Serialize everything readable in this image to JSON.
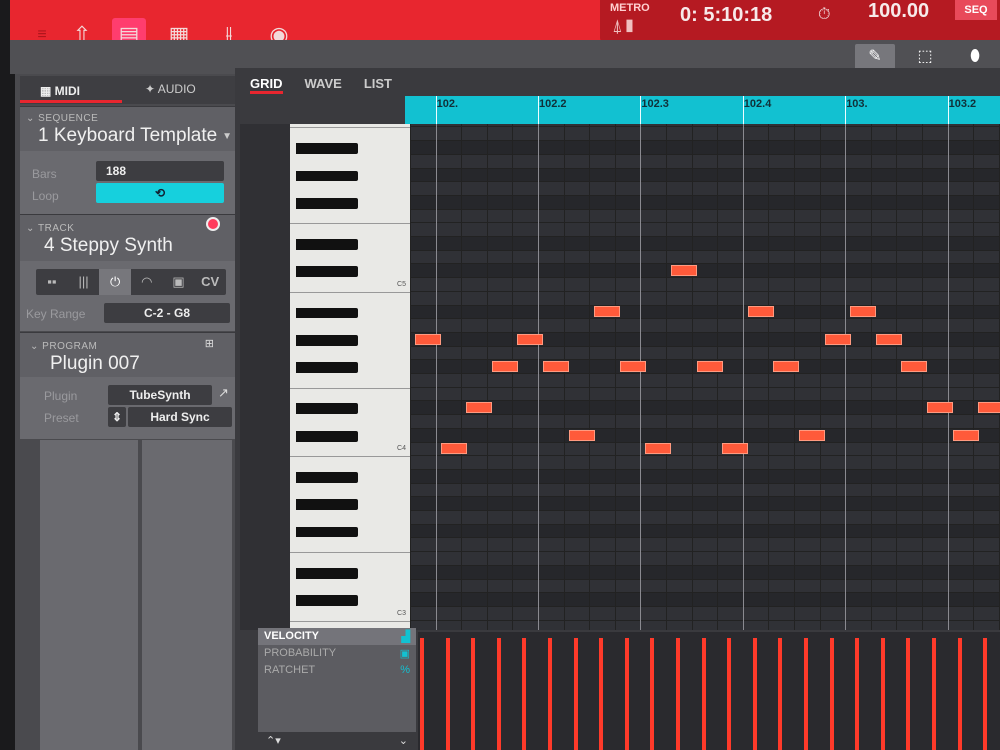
{
  "header": {
    "menu_icon": "hamburger-icon",
    "icons": [
      "home-arrow-icon",
      "track-view-icon",
      "pads-icon",
      "mixer-icon",
      "record-disc-icon"
    ],
    "metro_label": "METRO",
    "time": "0: 5:10:18",
    "tempo": "100.00",
    "seq_button": "SEQ"
  },
  "tools": [
    "pencil-icon",
    "select-icon",
    "eraser-icon"
  ],
  "left_tabs": {
    "midi": "MIDI",
    "audio": "AUDIO"
  },
  "sequence": {
    "header": "SEQUENCE",
    "name": "1 Keyboard Template",
    "bars_label": "Bars",
    "bars": "188",
    "loop_label": "Loop"
  },
  "track": {
    "header": "TRACK",
    "name": "4 Steppy Synth",
    "modes": [
      "pads",
      "keys",
      "plugin",
      "midi",
      "clip",
      "CV"
    ],
    "cv": "CV",
    "key_range_label": "Key Range",
    "key_range": "C-2 - G8"
  },
  "program": {
    "header": "PROGRAM",
    "name": "Plugin 007",
    "plugin_label": "Plugin",
    "plugin": "TubeSynth",
    "preset_label": "Preset",
    "preset": "Hard Sync"
  },
  "view_tabs": [
    "GRID",
    "WAVE",
    "LIST"
  ],
  "ruler": [
    {
      "label": "102.",
      "step": 1
    },
    {
      "label": "102.2",
      "step": 5
    },
    {
      "label": "102.3",
      "step": 9
    },
    {
      "label": "102.4",
      "step": 13
    },
    {
      "label": "103.",
      "step": 17
    },
    {
      "label": "103.2",
      "step": 21
    }
  ],
  "keyboard_labels": [
    {
      "label": "C5",
      "row": 0
    },
    {
      "label": "C4",
      "row": 12
    },
    {
      "label": "C3",
      "row": 24
    }
  ],
  "notes": [
    {
      "step": 0,
      "row": 4
    },
    {
      "step": 1,
      "row": 12
    },
    {
      "step": 2,
      "row": 9
    },
    {
      "step": 3,
      "row": 6
    },
    {
      "step": 4,
      "row": 4
    },
    {
      "step": 5,
      "row": 6
    },
    {
      "step": 6,
      "row": 11
    },
    {
      "step": 7,
      "row": 2
    },
    {
      "step": 8,
      "row": 6
    },
    {
      "step": 9,
      "row": 12
    },
    {
      "step": 10,
      "row": -1
    },
    {
      "step": 11,
      "row": 6
    },
    {
      "step": 12,
      "row": 12
    },
    {
      "step": 13,
      "row": 2
    },
    {
      "step": 14,
      "row": 6
    },
    {
      "step": 15,
      "row": 11
    },
    {
      "step": 16,
      "row": 4
    },
    {
      "step": 17,
      "row": 2
    },
    {
      "step": 18,
      "row": 4
    },
    {
      "step": 19,
      "row": 6
    },
    {
      "step": 20,
      "row": 9
    },
    {
      "step": 21,
      "row": 11
    },
    {
      "step": 22,
      "row": 9
    }
  ],
  "lanes": [
    "VELOCITY",
    "PROBABILITY",
    "RATCHET"
  ],
  "colors": {
    "accent": "#e8262f",
    "note": "#ff5a3a",
    "cyan": "#12c1d1"
  }
}
